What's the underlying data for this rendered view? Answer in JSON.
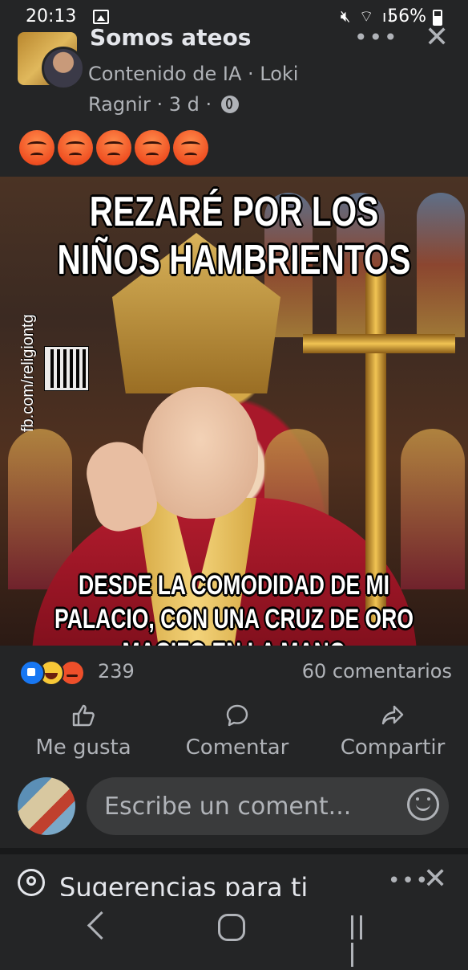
{
  "status_bar": {
    "time": "20:13",
    "icons": "mute-icon wifi-icon signal-icon",
    "battery": "56%"
  },
  "post": {
    "group_name": "Somos ateos",
    "author_line1": "Contenido de IA · Loki",
    "author_line2": "Ragnir · 3 d ·",
    "more": "•••",
    "close": "✕",
    "emoji_reactions": [
      "angry",
      "angry",
      "angry",
      "angry",
      "angry"
    ]
  },
  "meme": {
    "top_text": "REZARÉ POR LOS NIÑOS HAMBRIENTOS",
    "bottom_text": "DESDE LA COMODIDAD DE MI PALACIO, CON UNA CRUZ DE ORO MACIZO EN LA MANO",
    "watermark": "fb.com/religiontg"
  },
  "engagement": {
    "reaction_count": "239",
    "comments": "60 comentarios"
  },
  "actions": {
    "like": "Me gusta",
    "comment": "Comentar",
    "share": "Compartir"
  },
  "comment_box": {
    "placeholder": "Escribe un coment..."
  },
  "suggestions": {
    "title": "Sugerencias para ti",
    "more": "•••",
    "close": "✕"
  },
  "colors": {
    "background": "#242526",
    "text_primary": "#e4e6eb",
    "text_secondary": "#b0b3b8",
    "like_blue": "#1877f2",
    "angry_orange": "#f05022"
  }
}
